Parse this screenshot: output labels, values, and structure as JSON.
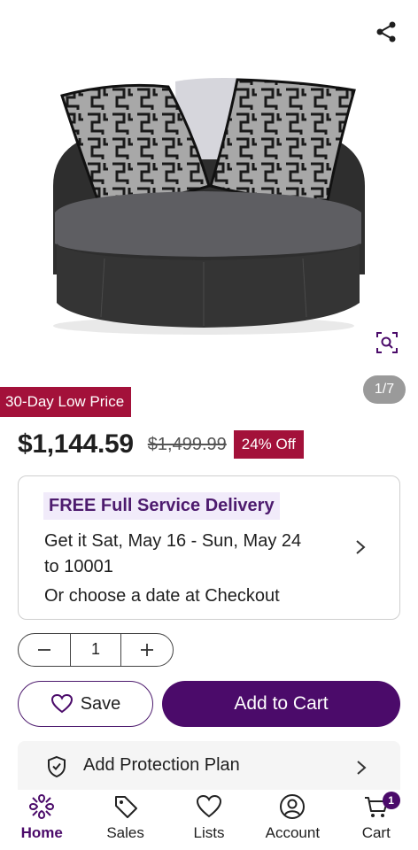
{
  "product": {
    "badge": "30-Day Low Price",
    "image_counter": "1/7"
  },
  "price": {
    "current": "$1,144.59",
    "original": "$1,499.99",
    "discount": "24% Off"
  },
  "delivery": {
    "title": "FREE Full Service Delivery",
    "line1": "Get it Sat, May 16 - Sun, May 24",
    "line2": "to 10001",
    "line3": "Or choose a date at Checkout"
  },
  "quantity": {
    "value": "1"
  },
  "actions": {
    "save_label": "Save",
    "add_to_cart_label": "Add to Cart"
  },
  "protection": {
    "label": "Add Protection Plan"
  },
  "nav": {
    "items": [
      {
        "label": "Home",
        "icon": "home-icon",
        "active": true
      },
      {
        "label": "Sales",
        "icon": "tag-icon"
      },
      {
        "label": "Lists",
        "icon": "heart-icon"
      },
      {
        "label": "Account",
        "icon": "account-icon"
      },
      {
        "label": "Cart",
        "icon": "cart-icon",
        "badge": "1"
      }
    ]
  },
  "colors": {
    "brand_purple": "#4b0b6a",
    "sale_red": "#a3113a",
    "delivery_highlight": "#f1ebfa"
  }
}
